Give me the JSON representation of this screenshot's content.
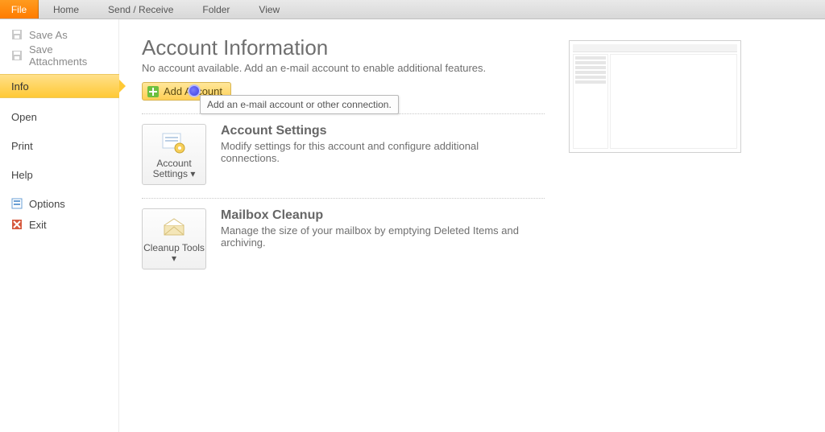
{
  "ribbon": {
    "file": "File",
    "tabs": [
      "Home",
      "Send / Receive",
      "Folder",
      "View"
    ]
  },
  "sidebar": {
    "items": [
      {
        "id": "save-as",
        "label": "Save As",
        "enabled": false,
        "icon": "save"
      },
      {
        "id": "save-attachments",
        "label": "Save Attachments",
        "enabled": false,
        "icon": "save"
      },
      {
        "id": "info",
        "label": "Info",
        "selected": true
      },
      {
        "id": "open",
        "label": "Open"
      },
      {
        "id": "print",
        "label": "Print"
      },
      {
        "id": "help",
        "label": "Help"
      },
      {
        "id": "options",
        "label": "Options",
        "icon": "options"
      },
      {
        "id": "exit",
        "label": "Exit",
        "icon": "exit"
      }
    ]
  },
  "page": {
    "title": "Account Information",
    "subtitle": "No account available. Add an e-mail account to enable additional features.",
    "add_button": "Add Account",
    "tooltip": "Add an e-mail account or other connection."
  },
  "sections": {
    "account_settings": {
      "button_label": "Account Settings",
      "dropdown_marker": "▾",
      "heading": "Account Settings",
      "body": "Modify settings for this account and configure additional connections."
    },
    "cleanup": {
      "button_label": "Cleanup Tools",
      "dropdown_marker": "▾",
      "heading": "Mailbox Cleanup",
      "body": "Manage the size of your mailbox by emptying Deleted Items and archiving."
    }
  }
}
